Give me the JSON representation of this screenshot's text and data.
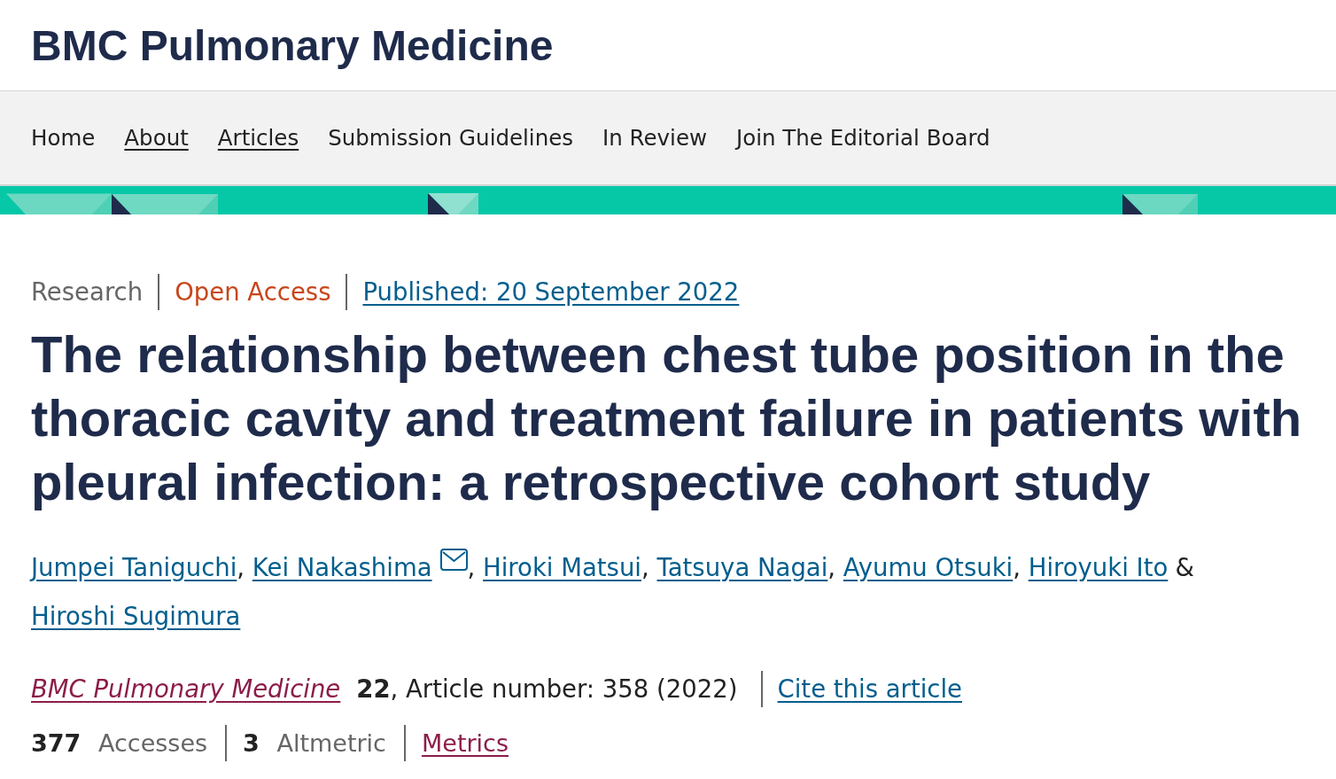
{
  "site": {
    "title": "BMC Pulmonary Medicine"
  },
  "nav": {
    "items": [
      {
        "label": "Home",
        "underlined": false
      },
      {
        "label": "About",
        "underlined": true
      },
      {
        "label": "Articles",
        "underlined": true
      },
      {
        "label": "Submission Guidelines",
        "underlined": false
      },
      {
        "label": "In Review",
        "underlined": false
      },
      {
        "label": "Join The Editorial Board",
        "underlined": false
      }
    ]
  },
  "article": {
    "labels": [
      {
        "text": "Research",
        "kind": "type"
      },
      {
        "text": "Open Access",
        "kind": "access"
      },
      {
        "text": "Published: 20 September 2022",
        "kind": "date"
      }
    ],
    "title": "The relationship between chest tube position in the thoracic cavity and treatment failure in patients with pleural infection: a retrospective cohort study",
    "authors": [
      {
        "name": "Jumpei Taniguchi",
        "email": false,
        "separator": {
          "text": ",",
          "kind": "comma"
        }
      },
      {
        "name": "Kei Nakashima",
        "email": true,
        "separator": {
          "text": ",",
          "kind": "comma"
        }
      },
      {
        "name": "Hiroki Matsui",
        "email": false,
        "separator": {
          "text": ",",
          "kind": "comma"
        }
      },
      {
        "name": "Tatsuya Nagai",
        "email": false,
        "separator": {
          "text": ",",
          "kind": "comma"
        }
      },
      {
        "name": "Ayumu Otsuki",
        "email": false,
        "separator": {
          "text": ",",
          "kind": "comma"
        }
      },
      {
        "name": "Hiroyuki Ito",
        "email": false,
        "separator": {
          "text": "&",
          "kind": "conjunction"
        }
      },
      {
        "name": "Hiroshi Sugimura",
        "email": false
      }
    ],
    "citation": {
      "journal": "BMC Pulmonary Medicine",
      "details": "**22**, Article number: 358 (2022)",
      "cite_link": "Cite this article"
    },
    "metrics": [
      {
        "kind": "stat",
        "text": "**377** Accesses"
      },
      {
        "kind": "stat",
        "text": "**3** Altmetric"
      },
      {
        "kind": "link",
        "text": "Metrics"
      }
    ]
  }
}
